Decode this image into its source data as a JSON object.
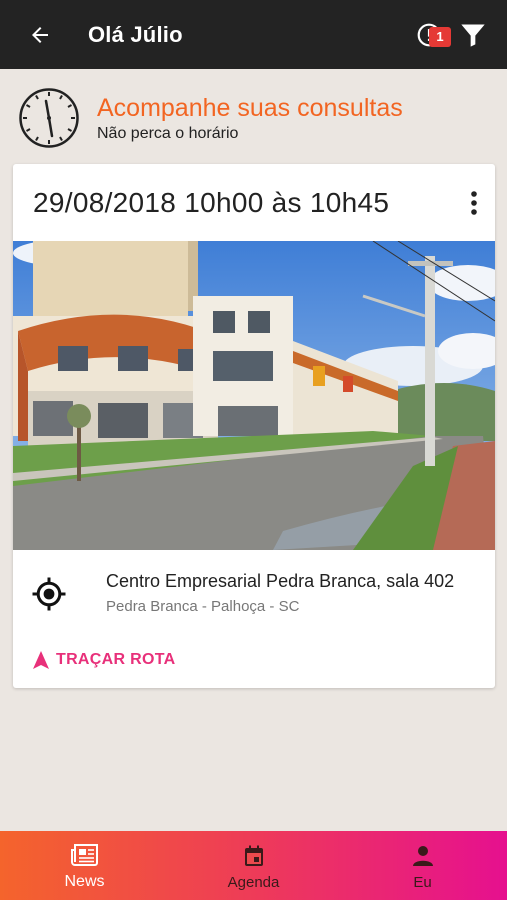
{
  "appbar": {
    "title": "Olá Júlio",
    "back_icon": "arrow-left-icon",
    "notification_count": "1",
    "notification_icon": "alert-circle-icon",
    "filter_icon": "filter-icon",
    "background": "#232323"
  },
  "header": {
    "icon": "clock-icon",
    "title": "Acompanhe suas consultas",
    "subtitle": "Não perca o horário",
    "title_color": "#f26522"
  },
  "appointment": {
    "datetime": "29/08/2018 10h00 às 10h45",
    "more_icon": "more-vertical-icon",
    "photo": "building-photo",
    "location_icon": "gps-target-icon",
    "location_name": "Centro Empresarial Pedra Branca, sala 402",
    "location_detail": "Pedra Branca - Palhoça - SC",
    "route_icon": "navigation-arrow-icon",
    "route_label": "TRAÇAR ROTA",
    "route_color": "#e8307a"
  },
  "bottom_nav": {
    "gradient": [
      "#f4642c",
      "#ee3b58",
      "#e6108f"
    ],
    "items": [
      {
        "label": "News",
        "icon": "newspaper-icon",
        "active": true
      },
      {
        "label": "Agenda",
        "icon": "calendar-icon",
        "active": false
      },
      {
        "label": "Eu",
        "icon": "person-icon",
        "active": false
      }
    ]
  }
}
